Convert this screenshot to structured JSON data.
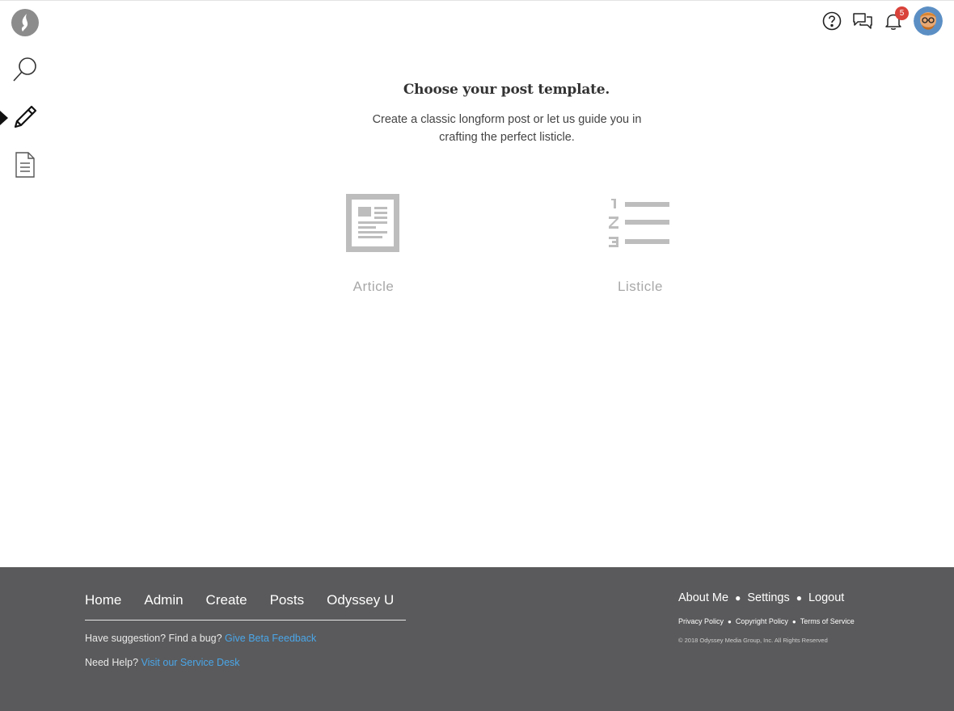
{
  "top_bar": {
    "notification_count": "5"
  },
  "chooser": {
    "heading": "Choose your post template.",
    "description": "Create a classic longform post or let us guide you in crafting the perfect listicle.",
    "templates": [
      {
        "label": "Article",
        "icon": "article-icon"
      },
      {
        "label": "Listicle",
        "icon": "listicle-icon"
      }
    ]
  },
  "footer": {
    "nav": [
      "Home",
      "Admin",
      "Create",
      "Posts",
      "Odyssey U"
    ],
    "feedback_text": "Have suggestion? Find a bug?",
    "feedback_link": "Give Beta Feedback",
    "help_text": "Need Help?",
    "help_link": "Visit our Service Desk",
    "account_links": [
      "About Me",
      "Settings",
      "Logout"
    ],
    "legal_links": [
      "Privacy Policy",
      "Copyright Policy",
      "Terms of Service"
    ],
    "copyright": "© 2018 Odyssey Media Group, Inc. All Rights Reserved"
  },
  "colors": {
    "footer_bg": "#5a5a5c",
    "link_blue": "#4aa6e8",
    "badge_red": "#d9423a",
    "icon_gray": "#bdbdbd"
  }
}
